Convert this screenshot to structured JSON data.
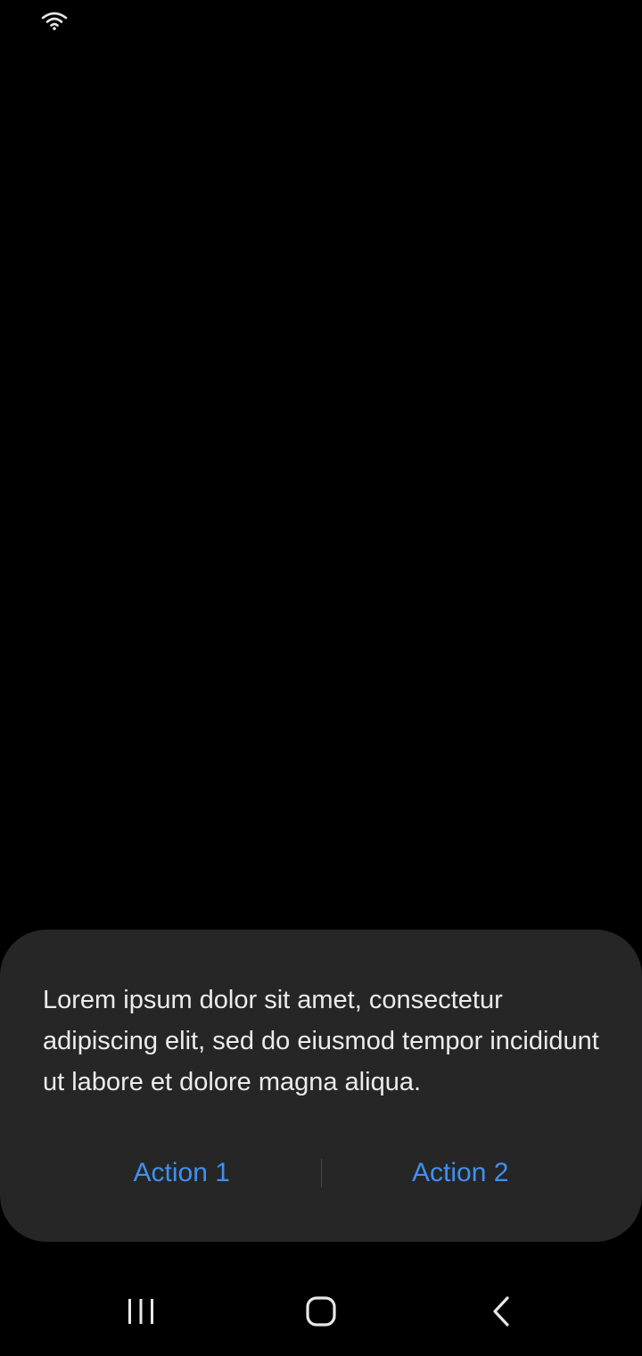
{
  "status_bar": {
    "icons": [
      "wifi-icon"
    ]
  },
  "dialog": {
    "message": "Lorem ipsum dolor sit amet, consectetur adipiscing elit, sed do eiusmod tempor incididunt ut labore et dolore magna aliqua.",
    "actions": [
      {
        "label": "Action 1"
      },
      {
        "label": "Action 2"
      }
    ]
  },
  "navigation_bar": {
    "buttons": [
      "recents-icon",
      "home-icon",
      "back-icon"
    ]
  },
  "colors": {
    "background": "#000000",
    "dialog_background": "#262626",
    "message_text": "#ececec",
    "action_text": "#3e91f4"
  }
}
